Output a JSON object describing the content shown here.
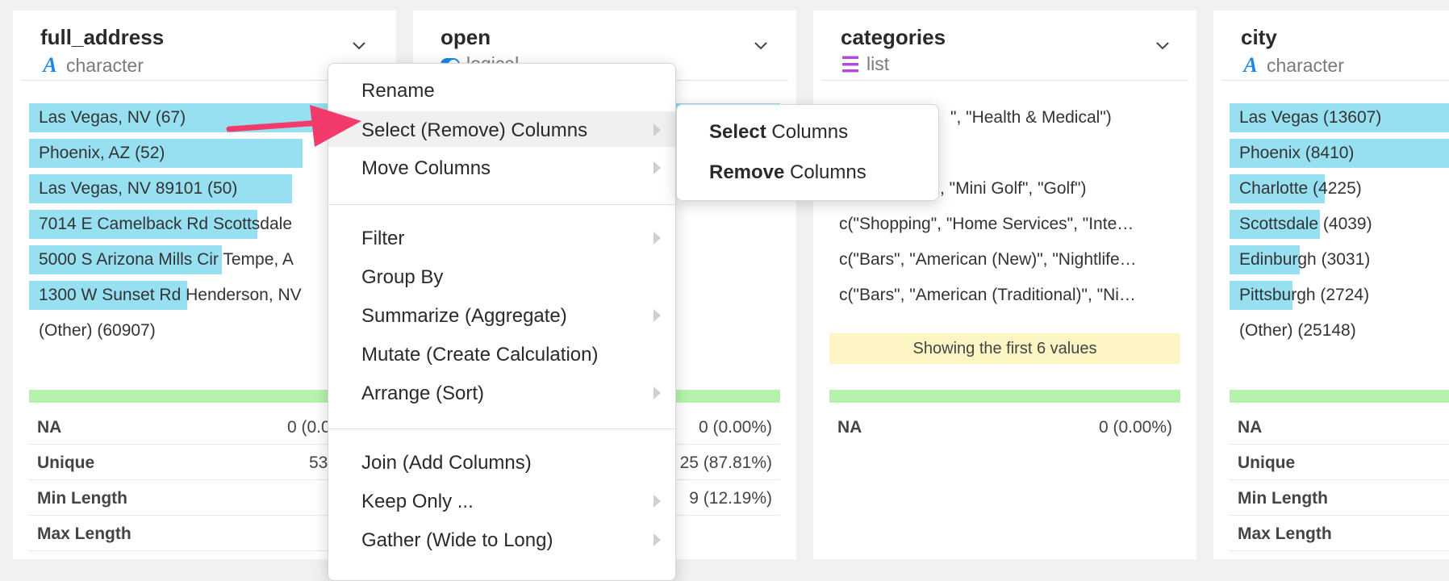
{
  "colors": {
    "bar_fill": "#97e0f2",
    "green_bar": "#b6f2ad",
    "notice_bg": "#fdf6c4",
    "arrow": "#f23b6a",
    "character_icon": "#1e88e5",
    "list_icon": "#b44bd8"
  },
  "cards": [
    {
      "title": "full_address",
      "type_label": "character",
      "type_icon": "character-icon",
      "bars": [
        {
          "label": "Las Vegas, NV (67)",
          "fill": 1.0
        },
        {
          "label": "Phoenix, AZ (52)",
          "fill": 0.78
        },
        {
          "label": "Las Vegas, NV 89101 (50)",
          "fill": 0.75
        },
        {
          "label": "7014 E Camelback Rd Scottsdale",
          "fill": 0.65
        },
        {
          "label": "5000 S Arizona Mills Cir Tempe, A",
          "fill": 0.55
        },
        {
          "label": "1300 W Sunset Rd Henderson, NV",
          "fill": 0.45
        }
      ],
      "other": "(Other) (60907)",
      "stats": [
        {
          "k": "NA",
          "v": "0 (0.0"
        },
        {
          "k": "Unique",
          "v": "53"
        },
        {
          "k": "Min Length",
          "v": ""
        },
        {
          "k": "Max Length",
          "v": ""
        }
      ]
    },
    {
      "title": "open",
      "type_label": "logical",
      "type_icon": "logical-icon",
      "stats": [
        {
          "k": "",
          "v": "0 (0.00%)"
        },
        {
          "k": "",
          "v": "25 (87.81%)"
        },
        {
          "k": "",
          "v": "9 (12.19%)"
        }
      ]
    },
    {
      "title": "categories",
      "type_label": "list",
      "type_icon": "list-icon",
      "values": [
        "\", \"Health & Medical\")",
        "",
        "fe\", \"Mini Golf\", \"Golf\")",
        "c(\"Shopping\", \"Home Services\", \"Inte…",
        "c(\"Bars\", \"American (New)\", \"Nightlife…",
        "c(\"Bars\", \"American (Traditional)\", \"Ni…"
      ],
      "notice": "Showing the first 6 values",
      "stats": [
        {
          "k": "NA",
          "v": "0 (0.00%)"
        }
      ]
    },
    {
      "title": "city",
      "type_label": "character",
      "type_icon": "character-icon",
      "bars": [
        {
          "label": "Las Vegas (13607)",
          "fill": 1.0
        },
        {
          "label": "Phoenix (8410)",
          "fill": 1.0
        },
        {
          "label": "Charlotte (4225)",
          "fill": 0.5
        },
        {
          "label": "Scottsdale (4039)",
          "fill": 0.48
        },
        {
          "label": "Edinburgh (3031)",
          "fill": 0.36
        },
        {
          "label": "Pittsburgh (2724)",
          "fill": 0.32
        }
      ],
      "other": "(Other) (25148)",
      "stats": [
        {
          "k": "NA",
          "v": ""
        },
        {
          "k": "Unique",
          "v": ""
        },
        {
          "k": "Min Length",
          "v": ""
        },
        {
          "k": "Max Length",
          "v": ""
        }
      ]
    }
  ],
  "menu": {
    "items": [
      {
        "label": "Rename",
        "submenu": false
      },
      {
        "label": "Select (Remove) Columns",
        "submenu": true,
        "highlighted": true
      },
      {
        "label": "Move Columns",
        "submenu": true
      },
      {
        "label": "Filter",
        "submenu": true
      },
      {
        "label": "Group By",
        "submenu": false
      },
      {
        "label": "Summarize (Aggregate)",
        "submenu": true
      },
      {
        "label": "Mutate (Create Calculation)",
        "submenu": false
      },
      {
        "label": "Arrange (Sort)",
        "submenu": true
      },
      {
        "label": "Join (Add Columns)",
        "submenu": false
      },
      {
        "label": "Keep Only ...",
        "submenu": true
      },
      {
        "label": "Gather (Wide to Long)",
        "submenu": true
      }
    ]
  },
  "submenu": {
    "select_bold": "Select",
    "select_rest": " Columns",
    "remove_bold": "Remove",
    "remove_rest": " Columns"
  }
}
